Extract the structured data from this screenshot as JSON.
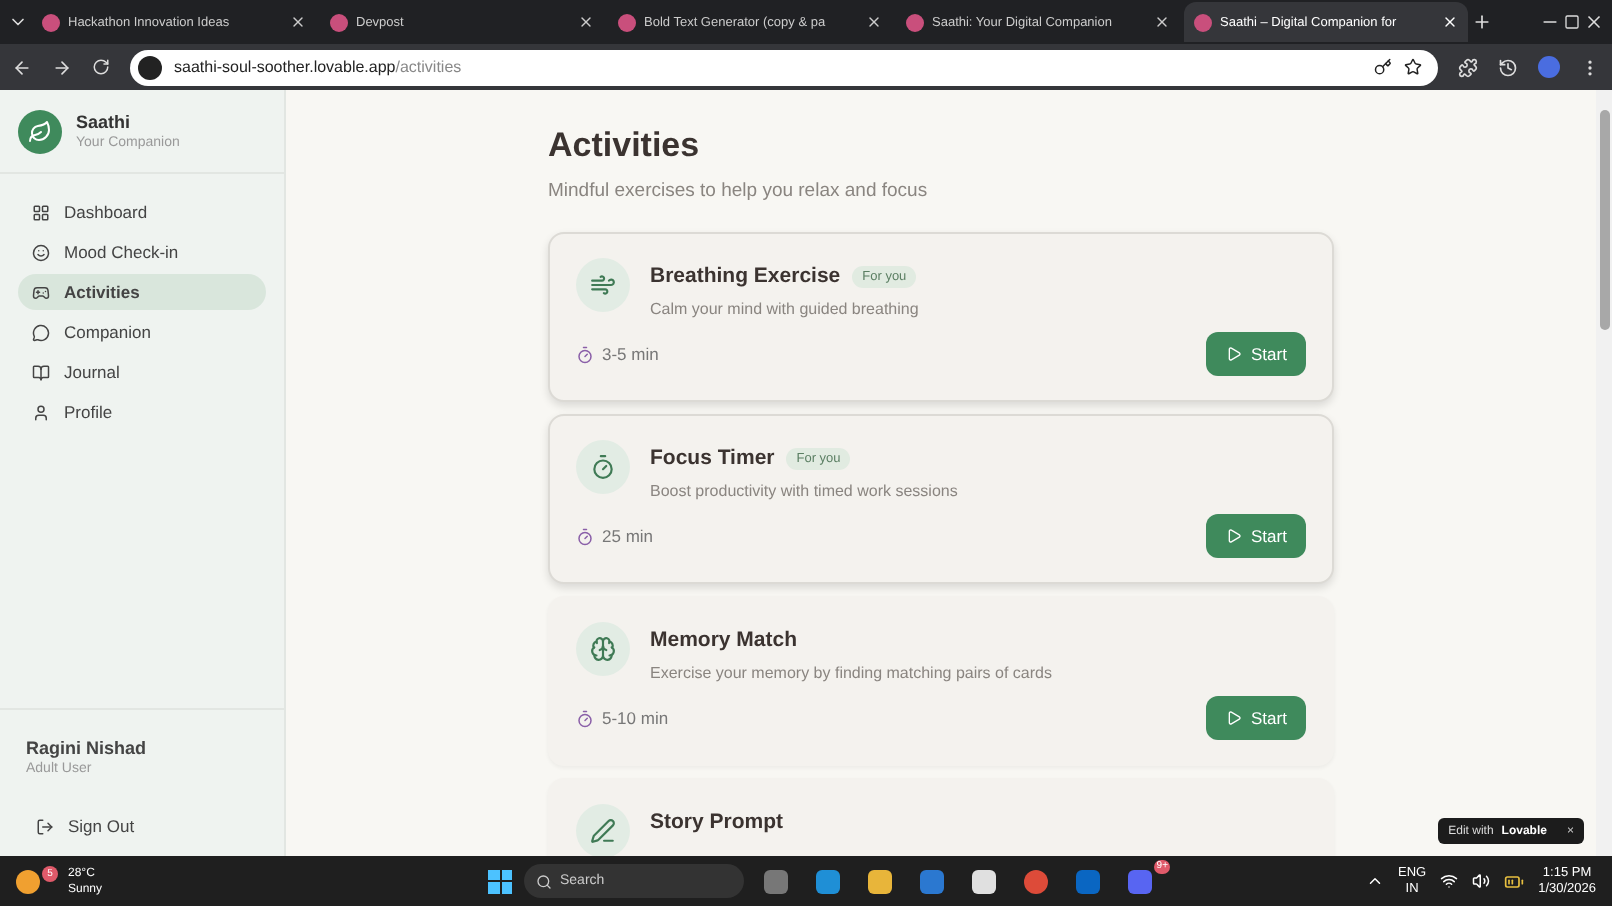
{
  "browser": {
    "tabs": [
      {
        "title": "Hackathon Innovation Ideas",
        "selected": false
      },
      {
        "title": "Devpost",
        "selected": false
      },
      {
        "title": "Bold Text Generator (copy & pa",
        "selected": false
      },
      {
        "title": "Saathi: Your Digital Companion",
        "selected": false
      },
      {
        "title": "Saathi – Digital Companion for",
        "selected": true
      }
    ],
    "url_host": "saathi-soul-soother.lovable.app",
    "url_path": "/activities"
  },
  "sidebar": {
    "app_name": "Saathi",
    "app_tagline": "Your Companion",
    "items": [
      {
        "label": "Dashboard",
        "selected": false
      },
      {
        "label": "Mood Check-in",
        "selected": false
      },
      {
        "label": "Activities",
        "selected": true
      },
      {
        "label": "Companion",
        "selected": false
      },
      {
        "label": "Journal",
        "selected": false
      },
      {
        "label": "Profile",
        "selected": false
      }
    ],
    "user_name": "Ragini Nishad",
    "user_role": "Adult User",
    "sign_out": "Sign Out"
  },
  "page": {
    "title": "Activities",
    "subtitle": "Mindful exercises to help you relax and focus",
    "activities": [
      {
        "title": "Breathing Exercise",
        "badge": "For you",
        "highlighted": true,
        "description": "Calm your mind with guided breathing",
        "duration": "3-5 min",
        "button": "Start"
      },
      {
        "title": "Focus Timer",
        "badge": "For you",
        "highlighted": true,
        "description": "Boost productivity with timed work sessions",
        "duration": "25 min",
        "button": "Start"
      },
      {
        "title": "Memory Match",
        "highlighted": false,
        "description": "Exercise your memory by finding matching pairs of cards",
        "duration": "5-10 min",
        "button": "Start"
      },
      {
        "title": "Story Prompt",
        "highlighted": false
      }
    ]
  },
  "lovable_badge": {
    "prefix": "Edit with",
    "brand": "Lovable",
    "close": "×"
  },
  "taskbar": {
    "weather_temp": "28°C",
    "weather_text": "Sunny",
    "weather_badge": "5",
    "search": "Search",
    "discord_badge": "9+",
    "lang_top": "ENG",
    "lang_bottom": "IN",
    "time": "1:15 PM",
    "date": "1/30/2026"
  }
}
